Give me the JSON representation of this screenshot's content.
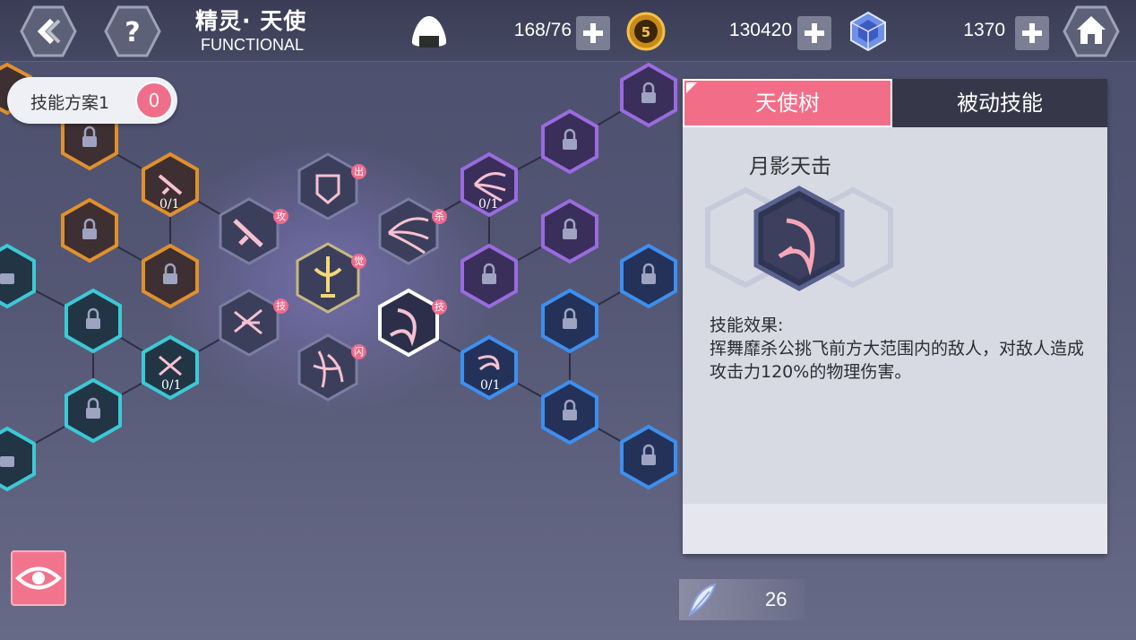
{
  "header": {
    "title": "精灵· 天使",
    "subtitle": "FUNCTIONAL",
    "back_icon": "back-chevron-icon",
    "help_icon": "question-icon",
    "home_icon": "home-icon"
  },
  "resources": {
    "stamina": {
      "icon": "rice-ball-icon",
      "value": "168/76"
    },
    "gold": {
      "icon": "gold-coin-icon",
      "value": "130420"
    },
    "crystal": {
      "icon": "blue-crystal-icon",
      "value": "1370"
    }
  },
  "preset": {
    "label": "技能方案1",
    "count": "0"
  },
  "tree": {
    "center_tags": [
      "出",
      "杀",
      "攻",
      "觉",
      "技",
      "闪",
      "技"
    ],
    "counters": [
      "0/1",
      "0/1",
      "0/1",
      "0/1"
    ]
  },
  "panel": {
    "tabs": [
      "天使树",
      "被动技能"
    ],
    "skill_name": "月影天击",
    "effect_heading": "技能效果:",
    "effect_text": "挥舞靡杀公挑飞前方大范围内的敌人，对敌人造成攻击力120%的物理伤害。"
  },
  "feather": {
    "icon": "feather-icon",
    "value": "26"
  },
  "colors": {
    "accent_pink": "#f26e88",
    "orange_branch": "#e0902c",
    "teal_branch": "#3cc9d6",
    "purple_branch": "#9a6be0",
    "blue_branch": "#3d8ff0"
  }
}
